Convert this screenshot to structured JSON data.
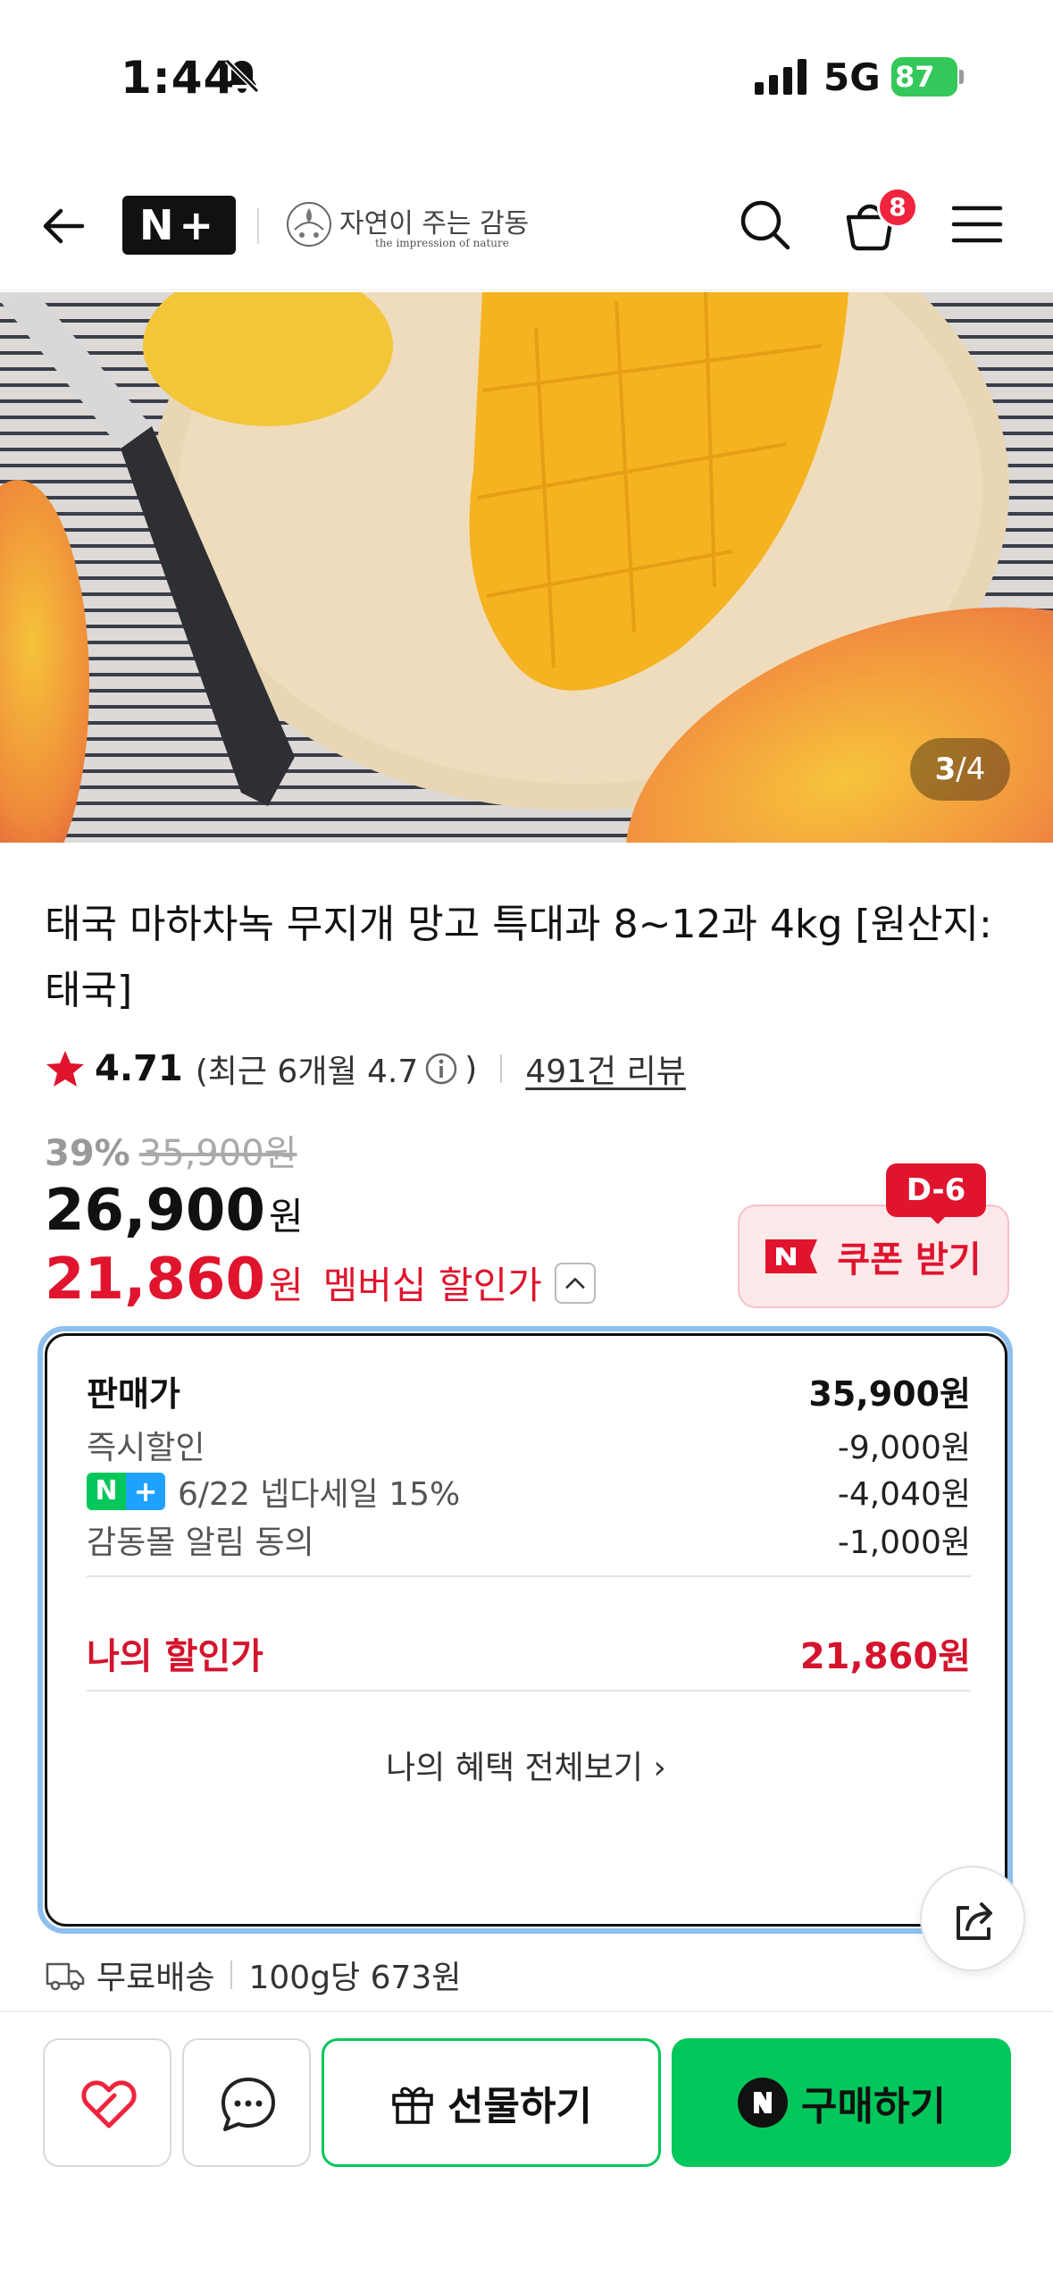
{
  "status_bar": {
    "time": "1:44",
    "network": "5G",
    "battery": "87"
  },
  "header": {
    "logo_text": "N+",
    "brand_name": "자연이 주는 감동",
    "brand_sub": "the impression of nature",
    "cart_count": "8"
  },
  "hero": {
    "current": "3",
    "separator": "/",
    "total": "4"
  },
  "product": {
    "title": "태국 마하차녹 무지개 망고 특대과 8~12과 4kg [원산지:태국]"
  },
  "rating": {
    "score": "4.71",
    "recent_prefix": "(최근 6개월 4.7",
    "recent_suffix": ")",
    "reviews": "491건 리뷰"
  },
  "price": {
    "discount_pct": "39%",
    "original": "35,900원",
    "sale": "26,900",
    "won": "원",
    "member": "21,860",
    "member_won": "원",
    "member_label": "멤버십 할인가"
  },
  "coupon": {
    "dday": "D-6",
    "label": "쿠폰 받기"
  },
  "breakdown": {
    "rows": [
      {
        "label": "판매가",
        "value": "35,900원"
      },
      {
        "label": "즉시할인",
        "value": "-9,000원"
      },
      {
        "label": "6/22 넵다세일 15%",
        "value": "-4,040원"
      },
      {
        "label": "감동몰 알림 동의",
        "value": "-1,000원"
      }
    ],
    "my_label": "나의 할인가",
    "my_value": "21,860원",
    "more": "나의 혜택 전체보기 ›"
  },
  "shipping": {
    "free": "무료배송",
    "unit_price": "100g당 673원"
  },
  "bottom": {
    "gift": "선물하기",
    "buy": "구매하기"
  },
  "colors": {
    "naver_green": "#03c75a",
    "sale_red": "#e0142d",
    "focus_blue": "#8ec0ef"
  }
}
